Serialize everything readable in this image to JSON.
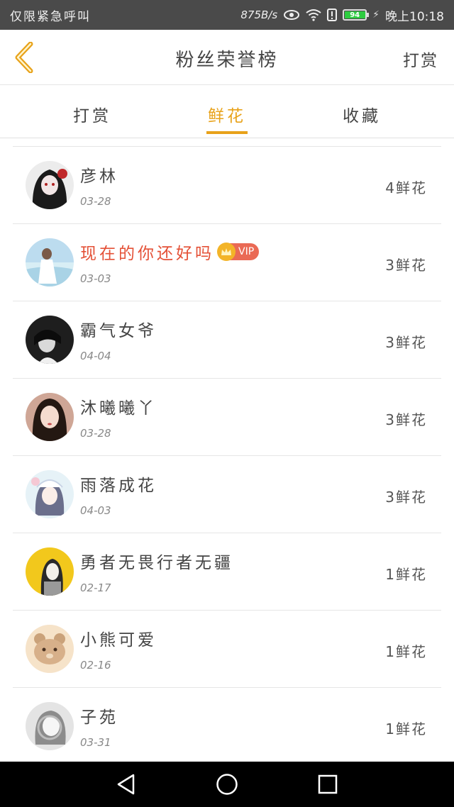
{
  "status_bar": {
    "carrier": "仅限紧急呼叫",
    "speed": "875B/s",
    "battery_level": "94",
    "time": "晚上10:18"
  },
  "header": {
    "title": "粉丝荣誉榜",
    "right_action": "打赏",
    "back_icon": "chevron-left-icon"
  },
  "tabs": [
    {
      "label": "打赏",
      "active": false
    },
    {
      "label": "鲜花",
      "active": true
    },
    {
      "label": "收藏",
      "active": false
    }
  ],
  "colors": {
    "accent": "#e8a21a",
    "vip_name": "#e45036",
    "vip_badge": "#ea6a55"
  },
  "fans": [
    {
      "name": "彦林",
      "date": "03-28",
      "count": "4鲜花",
      "vip": false
    },
    {
      "name": "现在的你还好吗",
      "date": "03-03",
      "count": "3鲜花",
      "vip": true,
      "badge": "VIP"
    },
    {
      "name": "霸气女爷",
      "date": "04-04",
      "count": "3鲜花",
      "vip": false
    },
    {
      "name": "沐曦曦丫",
      "date": "03-28",
      "count": "3鲜花",
      "vip": false
    },
    {
      "name": "雨落成花",
      "date": "04-03",
      "count": "3鲜花",
      "vip": false
    },
    {
      "name": "勇者无畏行者无疆",
      "date": "02-17",
      "count": "1鲜花",
      "vip": false
    },
    {
      "name": "小熊可爱",
      "date": "02-16",
      "count": "1鲜花",
      "vip": false
    },
    {
      "name": "子苑",
      "date": "03-31",
      "count": "1鲜花",
      "vip": false
    }
  ],
  "nav": {
    "back": "triangle-back-icon",
    "home": "circle-home-icon",
    "recents": "square-recents-icon"
  }
}
